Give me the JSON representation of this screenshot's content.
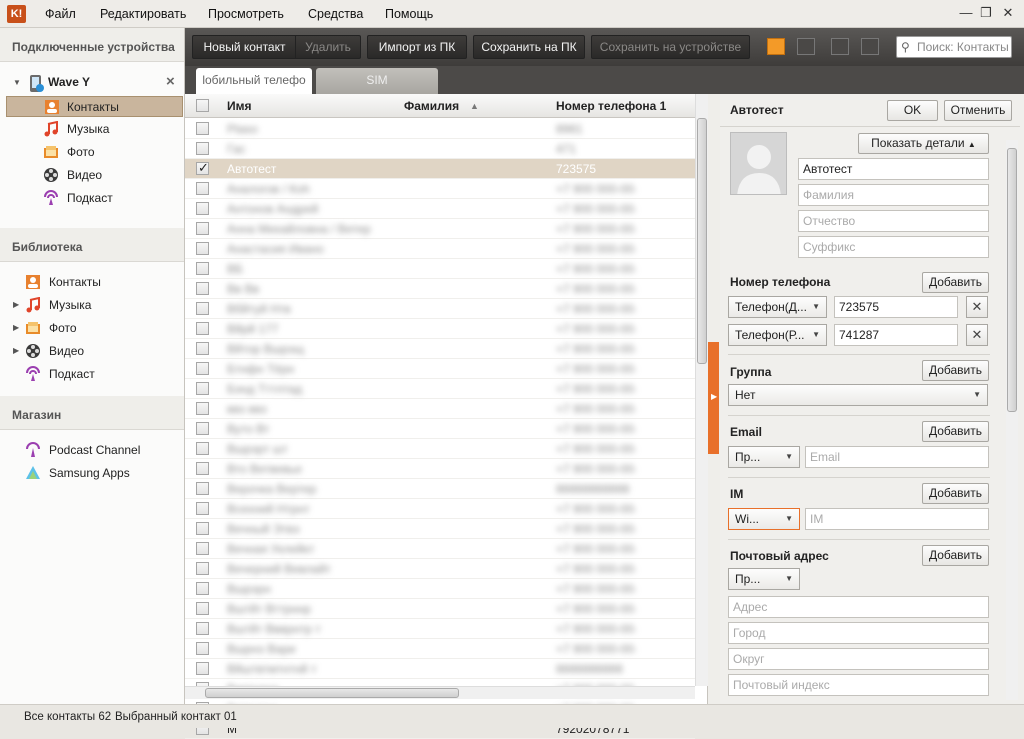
{
  "app": {
    "logo_text": "K!"
  },
  "menu": [
    "Файл",
    "Редактировать",
    "Просмотреть",
    "Средства",
    "Помощь"
  ],
  "sidebar": {
    "devices_header": "Подключенные устройства",
    "device_name": "Wave Y",
    "device_close": "×",
    "device_items": [
      "Контакты",
      "Музыка",
      "Фото",
      "Видео",
      "Подкаст"
    ],
    "library_header": "Библиотека",
    "library_items": [
      "Контакты",
      "Музыка",
      "Фото",
      "Видео",
      "Подкаст"
    ],
    "store_header": "Магазин",
    "store_items": [
      "Podcast Channel",
      "Samsung Apps"
    ]
  },
  "toolbar": {
    "new_contact": "Новый контакт",
    "delete": "Удалить",
    "import_pc": "Импорт из ПК",
    "save_pc": "Сохранить на ПК",
    "save_device": "Сохранить на устройстве",
    "search_placeholder": "Поиск: Контакты"
  },
  "tabs": [
    "lобильный телефо",
    "SIM"
  ],
  "list": {
    "headers": {
      "name": "Имя",
      "surname": "Фамилия",
      "phone": "Номер телефона 1"
    },
    "rows": [
      {
        "name": "Ptaso",
        "phone": "8981",
        "checked": false,
        "selected": false
      },
      {
        "name": "Гас",
        "phone": "471",
        "checked": false,
        "selected": false
      },
      {
        "name": "Автотест",
        "phone": "723575",
        "checked": true,
        "selected": true
      },
      {
        "name": "Аналогов / Кoh",
        "phone": "+7 900 000-00-00",
        "checked": false,
        "selected": false
      },
      {
        "name": "Антонов Андрей",
        "phone": "+7 900 000-00-00",
        "checked": false,
        "selected": false
      },
      {
        "name": "Анна Михайловна / Ветер",
        "phone": "+7 900 000-00-00",
        "checked": false,
        "selected": false
      },
      {
        "name": "Анастасия Ивано",
        "phone": "+7 900 000-00-00",
        "checked": false,
        "selected": false
      },
      {
        "name": "ВБ",
        "phone": "+7 900 000-00-00",
        "checked": false,
        "selected": false
      },
      {
        "name": "Вв Вв",
        "phone": "+7 900 000-00-00",
        "checked": false,
        "selected": false
      },
      {
        "name": "Вбйтуй Нтв",
        "phone": "+7 900 000-00-00",
        "checked": false,
        "selected": false
      },
      {
        "name": "Вйрй 177",
        "phone": "+7 900 000-00-00",
        "checked": false,
        "selected": false
      },
      {
        "name": "Вйтор Вшрэщ",
        "phone": "+7 900 000-00-00",
        "checked": false,
        "selected": false
      },
      {
        "name": "Бтнфн Тёрн",
        "phone": "+7 900 000-00-00",
        "checked": false,
        "selected": false
      },
      {
        "name": "Бэнд Тттлтад",
        "phone": "+7 900 000-00-00",
        "checked": false,
        "selected": false
      },
      {
        "name": "ввз ввз",
        "phone": "+7 900 000-00-00",
        "checked": false,
        "selected": false
      },
      {
        "name": "Вуто Вт",
        "phone": "+7 900 000-00-00",
        "checked": false,
        "selected": false
      },
      {
        "name": "Вшрэрт шт",
        "phone": "+7 900 000-00-00",
        "checked": false,
        "selected": false
      },
      {
        "name": "Вто Ветвевье",
        "phone": "+7 900 000-00-00",
        "checked": false,
        "selected": false
      },
      {
        "name": "Верочка Вертер",
        "phone": "88888888888",
        "checked": false,
        "selected": false
      },
      {
        "name": "Всехний Нтрнт",
        "phone": "+7 900 000-00-00",
        "checked": false,
        "selected": false
      },
      {
        "name": "Вечный Этвэ",
        "phone": "+7 900 000-00-00",
        "checked": false,
        "selected": false
      },
      {
        "name": "Вечная Уклейкт",
        "phone": "+7 900 000-00-00",
        "checked": false,
        "selected": false
      },
      {
        "name": "Вечерний Вевлайт",
        "phone": "+7 900 000-00-00",
        "checked": false,
        "selected": false
      },
      {
        "name": "Вшрэрн",
        "phone": "+7 900 000-00-00",
        "checked": false,
        "selected": false
      },
      {
        "name": "Вштйт Вттрннр",
        "phone": "+7 900 000-00-00",
        "checked": false,
        "selected": false
      },
      {
        "name": "Вштйт Ввврнтр т",
        "phone": "+7 900 000-00-00",
        "checked": false,
        "selected": false
      },
      {
        "name": "Вшрнэ Вари",
        "phone": "+7 900 000-00-00",
        "checked": false,
        "selected": false
      },
      {
        "name": "Вйштвтмтнтнй т",
        "phone": "8888888888",
        "checked": false,
        "selected": false
      },
      {
        "name": "Виртуэнэ",
        "phone": "+7 900 000-00-00",
        "checked": false,
        "selected": false
      },
      {
        "name": "Вттвнтрр",
        "phone": "+7 900 000-00-00",
        "checked": false,
        "selected": false
      },
      {
        "name": "М",
        "phone": "79202078771",
        "checked": false,
        "selected": false
      }
    ]
  },
  "detail": {
    "title": "Автотест",
    "ok": "OK",
    "cancel": "Отменить",
    "show_details": "Показать детали",
    "first_name": "Автотест",
    "surname_ph": "Фамилия",
    "patronymic_ph": "Отчество",
    "suffix_ph": "Суффикс",
    "phone_label": "Номер телефона",
    "add": "Добавить",
    "phones": [
      {
        "type": "Телефон(Д...",
        "value": "723575"
      },
      {
        "type": "Телефон(Р...",
        "value": "741287"
      }
    ],
    "group_label": "Группа",
    "group_value": "Нет",
    "email_label": "Email",
    "email_type": "Пр...",
    "email_ph": "Email",
    "im_label": "IM",
    "im_type": "Wi...",
    "im_ph": "IM",
    "address_label": "Почтовый адрес",
    "address_type": "Пр...",
    "address_fields": [
      "Адрес",
      "Город",
      "Округ",
      "Почтовый индекс"
    ]
  },
  "status": {
    "all_contacts": "Все контакты 62",
    "selected": "Выбранный контакт 01"
  },
  "colors": {
    "accent": "#e8702a",
    "toolbar": "#3e3c3a",
    "selection": "#c9b59d"
  }
}
